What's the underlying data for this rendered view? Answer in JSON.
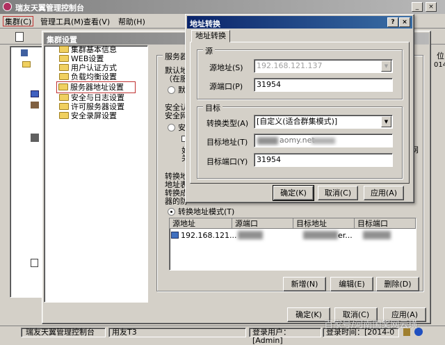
{
  "main_window": {
    "title": "瑞友天翼管理控制台",
    "menu": [
      "集群(C)",
      "管理工具(M)",
      "查看(V)",
      "帮助(H)"
    ],
    "status": {
      "app_name": "瑞友天翼管理控制台",
      "edition": "用友T3",
      "login_user": "登录用户：[Admin]",
      "login_time": "登录时间：[2014-0"
    },
    "right_edge_text": [
      "位",
      "014"
    ]
  },
  "cluster_dialog": {
    "title": "集群设置",
    "tree": [
      "集群基本信息",
      "WEB设置",
      "用户认证方式",
      "负载均衡设置",
      "服务器地址设置",
      "安全与日志设置",
      "许可服务器设置",
      "安全录屏设置"
    ],
    "selected_index": 4,
    "section_label": "服务器地",
    "default_text": "默认地",
    "default_sub": "（在服",
    "default_radio": "默认",
    "secure_text": "安全认",
    "secure_text2": "安全网",
    "secure_radio": "安全",
    "side_a": "如",
    "side_b": "关",
    "side_right": "网",
    "translate_lines": [
      "转换地",
      "地址表",
      "转换成",
      "器的防"
    ],
    "translate_mode_label": "转换地址模式(T)",
    "table_headers": [
      "源地址",
      "源端口",
      "目标地址",
      "目标端口"
    ],
    "table_row": {
      "src": "192.168.121...",
      "target_tail": "er..."
    },
    "list_buttons": [
      "新增(N)",
      "编辑(E)",
      "删除(D)"
    ],
    "buttons": [
      "确定(K)",
      "取消(C)",
      "应用(A)"
    ]
  },
  "address_dialog": {
    "title": "地址转换",
    "help_glyph": "?",
    "close_glyph": "×",
    "tab": "地址转换",
    "source_group": "源",
    "source_address_label": "源地址(S)",
    "source_address_value": "192.168.121.137",
    "source_port_label": "源端口(P)",
    "source_port_value": "31954",
    "target_group": "目标",
    "convert_type_label": "转换类型(A)",
    "convert_type_value": "[自定义(适合群集模式)]",
    "target_address_label": "目标地址(T)",
    "target_address_value": "aomy.net",
    "target_port_label": "目标端口(Y)",
    "target_port_value": "31954",
    "buttons": [
      "确定(K)",
      "取消(C)",
      "应用(A)"
    ]
  },
  "watermark": "百家号/河南国奖网云璜"
}
